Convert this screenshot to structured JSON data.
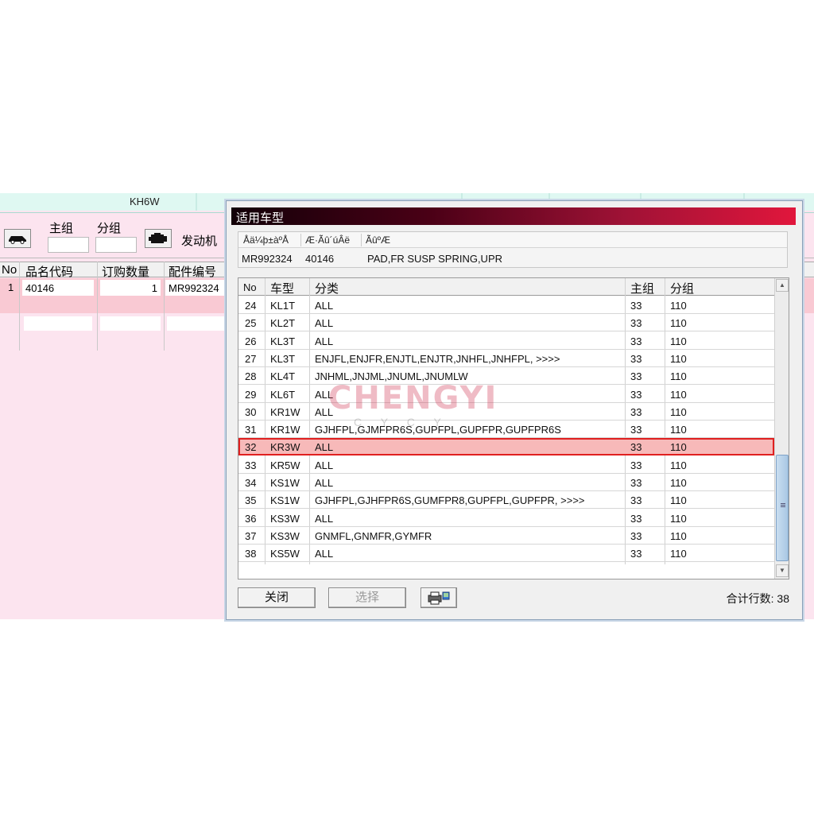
{
  "background": {
    "top_cell": "KH6W",
    "toolbar": {
      "main_group_label": "主组",
      "sub_group_label": "分组",
      "engine_label": "发动机",
      "car_icon": "car-icon",
      "engine_icon": "engine-icon"
    },
    "grid_headers": [
      "No",
      "品名代码",
      "订购数量",
      "配件编号"
    ],
    "row": {
      "no": "1",
      "code": "40146",
      "qty": "1",
      "part": "MR992324"
    }
  },
  "dialog": {
    "title": "适用车型",
    "part_headers": [
      "Åä¼þ±àºÅ",
      "Æ·Ãû´úÂë",
      "ÃûºÆ"
    ],
    "part_values": {
      "part_no": "MR992324",
      "code": "40146",
      "name": "PAD,FR SUSP SPRING,UPR"
    },
    "columns": [
      "No",
      "车型",
      "分类",
      "主组",
      "分组"
    ],
    "rows": [
      {
        "no": "24",
        "model": "KL1T",
        "cat": "ALL",
        "main": "33",
        "sub": "110"
      },
      {
        "no": "25",
        "model": "KL2T",
        "cat": "ALL",
        "main": "33",
        "sub": "110"
      },
      {
        "no": "26",
        "model": "KL3T",
        "cat": "ALL",
        "main": "33",
        "sub": "110"
      },
      {
        "no": "27",
        "model": "KL3T",
        "cat": "ENJFL,ENJFR,ENJTL,ENJTR,JNHFL,JNHFPL,  >>>>",
        "main": "33",
        "sub": "110"
      },
      {
        "no": "28",
        "model": "KL4T",
        "cat": "JNHML,JNJML,JNUML,JNUMLW",
        "main": "33",
        "sub": "110"
      },
      {
        "no": "29",
        "model": "KL6T",
        "cat": "ALL",
        "main": "33",
        "sub": "110"
      },
      {
        "no": "30",
        "model": "KR1W",
        "cat": "ALL",
        "main": "33",
        "sub": "110"
      },
      {
        "no": "31",
        "model": "KR1W",
        "cat": "GJHFPL,GJMFPR6S,GUPFPL,GUPFPR,GUPFPR6S",
        "main": "33",
        "sub": "110"
      },
      {
        "no": "32",
        "model": "KR3W",
        "cat": "ALL",
        "main": "33",
        "sub": "110",
        "selected": true
      },
      {
        "no": "33",
        "model": "KR5W",
        "cat": "ALL",
        "main": "33",
        "sub": "110"
      },
      {
        "no": "34",
        "model": "KS1W",
        "cat": "ALL",
        "main": "33",
        "sub": "110"
      },
      {
        "no": "35",
        "model": "KS1W",
        "cat": "GJHFPL,GJHFPR6S,GUMFPR8,GUPFPL,GUPFPR,  >>>>",
        "main": "33",
        "sub": "110"
      },
      {
        "no": "36",
        "model": "KS3W",
        "cat": "ALL",
        "main": "33",
        "sub": "110"
      },
      {
        "no": "37",
        "model": "KS3W",
        "cat": "GNMFL,GNMFR,GYMFR",
        "main": "33",
        "sub": "110"
      },
      {
        "no": "38",
        "model": "KS5W",
        "cat": "ALL",
        "main": "33",
        "sub": "110"
      }
    ],
    "close_label": "关闭",
    "select_label": "选择",
    "print_icon": "printer-icon",
    "total_label": "合计行数: 38"
  },
  "watermark": {
    "text": "CHENGYI",
    "sub": "C Y C Y"
  },
  "colors": {
    "selected_row": "#f7b9b9",
    "selected_border": "#e02020",
    "title_end": "#e1163c",
    "background_pink": "#fce4ef"
  }
}
